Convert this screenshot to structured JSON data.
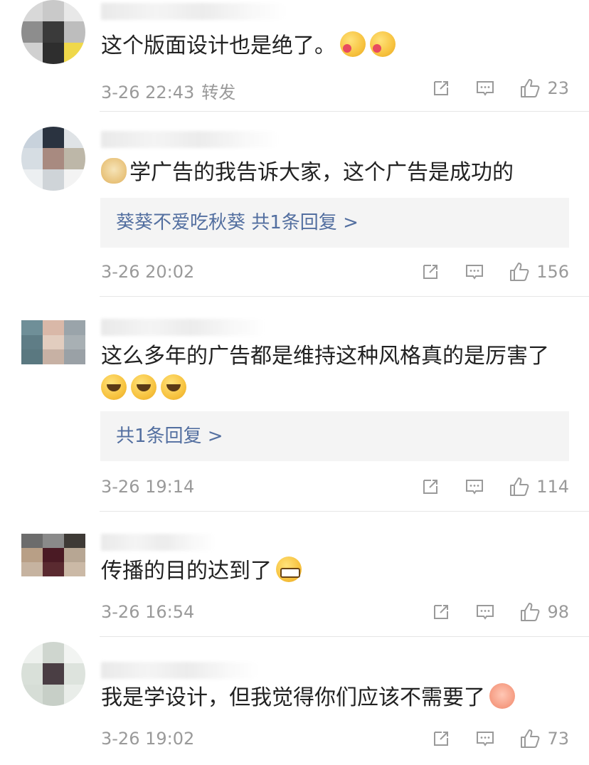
{
  "comments": [
    {
      "username": "",
      "text": "这个版面设计也是绝了。",
      "emojis": [
        "heart",
        "heart"
      ],
      "time": "3-26 22:43",
      "forward_label": "转发",
      "likes": "23"
    },
    {
      "username": "",
      "text": "学广告的我告诉大家，这个广告是成功的",
      "leading_emoji": "dog",
      "reply": "葵葵不爱吃秋葵  共1条回复 >",
      "time": "3-26 20:02",
      "likes": "156"
    },
    {
      "username": "",
      "text": "这么多年的广告都是维持这种风格真的是厉害了",
      "emojis": [
        "cry",
        "cry",
        "cry"
      ],
      "reply": "共1条回复 >",
      "time": "3-26 19:14",
      "likes": "114"
    },
    {
      "username": "",
      "text": "传播的目的达到了",
      "emojis": [
        "grin"
      ],
      "time": "3-26 16:54",
      "likes": "98"
    },
    {
      "username": "",
      "text": "我是学设计，但我觉得你们应该不需要了",
      "emojis": [
        "pig"
      ],
      "time": "3-26 19:02",
      "likes": "73"
    }
  ],
  "icons": {
    "share": "share-icon",
    "comment": "comment-icon",
    "like": "thumbs-up-icon"
  },
  "colors": {
    "reply_link": "#536fa0",
    "meta": "#9a9a9a",
    "reply_bg": "#f4f4f4"
  }
}
